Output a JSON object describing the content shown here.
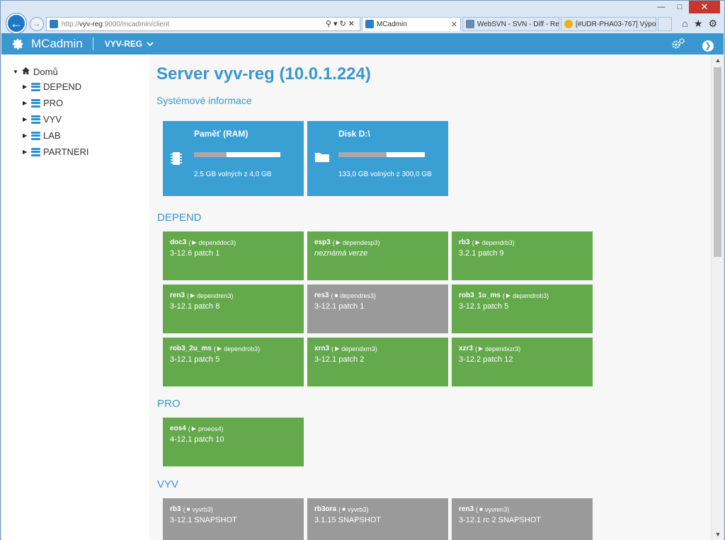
{
  "browser": {
    "url_prefix": "http://",
    "url_host": "vyv-reg",
    "url_rest": ":9000/mcadmin/client",
    "tabs": [
      {
        "label": "MCadmin",
        "active": true
      },
      {
        "label": "WebSVN - SVN - Diff - Re...",
        "active": false
      },
      {
        "label": "[#UDR-PHA03-767] Výpo...",
        "active": false
      }
    ]
  },
  "header": {
    "app_title": "MCadmin",
    "server_selector": "VYV-REG"
  },
  "sidebar": {
    "root": "Domů",
    "items": [
      {
        "label": "DEPEND"
      },
      {
        "label": "PRO"
      },
      {
        "label": "VYV"
      },
      {
        "label": "LAB"
      },
      {
        "label": "PARTNERI"
      }
    ]
  },
  "main": {
    "title": "Server vyv-reg (10.0.1.224)",
    "system_section": "Systémové informace",
    "ram": {
      "title": "Paměť (RAM)",
      "subtitle": "2,5 GB volných z 4,0 GB",
      "used_fraction": 0.375
    },
    "disk": {
      "title": "Disk D:\\",
      "subtitle": "133,0 GB volných z 300,0 GB",
      "used_fraction": 0.557
    },
    "groups": [
      {
        "name": "DEPEND",
        "servers": [
          {
            "name": "doc3",
            "instance": "dependdoc3",
            "version": "3-12.6 patch 1",
            "running": true,
            "unknown": false
          },
          {
            "name": "esp3",
            "instance": "dependesp3",
            "version": "neznámá verze",
            "running": true,
            "unknown": true
          },
          {
            "name": "rb3",
            "instance": "dependrb3",
            "version": "3.2.1 patch 9",
            "running": true,
            "unknown": false
          },
          {
            "name": "ren3",
            "instance": "dependren3",
            "version": "3-12.1 patch 8",
            "running": true,
            "unknown": false
          },
          {
            "name": "res3",
            "instance": "dependres3",
            "version": "3-12.1 patch 1",
            "running": false,
            "unknown": false
          },
          {
            "name": "rob3_1u_ms",
            "instance": "dependrob3",
            "version": "3-12.1 patch 5",
            "running": true,
            "unknown": false
          },
          {
            "name": "rob3_2u_ms",
            "instance": "dependrob3",
            "version": "3-12.1 patch 5",
            "running": true,
            "unknown": false
          },
          {
            "name": "xrn3",
            "instance": "dependxrn3",
            "version": "3-12.1 patch 2",
            "running": true,
            "unknown": false
          },
          {
            "name": "xzr3",
            "instance": "dependxzr3",
            "version": "3-12.2 patch 12",
            "running": true,
            "unknown": false
          }
        ]
      },
      {
        "name": "PRO",
        "servers": [
          {
            "name": "eos4",
            "instance": "proeos4",
            "version": "4-12.1 patch 10",
            "running": true,
            "unknown": false
          }
        ]
      },
      {
        "name": "VYV",
        "servers": [
          {
            "name": "rb3",
            "instance": "vyvrb3",
            "version": "3-12.1 SNAPSHOT",
            "running": false,
            "unknown": false
          },
          {
            "name": "rb3ora",
            "instance": "vyvrb3",
            "version": "3.1.15 SNAPSHOT",
            "running": false,
            "unknown": false
          },
          {
            "name": "ren3",
            "instance": "vyvren3",
            "version": "3-12.1 rc 2 SNAPSHOT",
            "running": false,
            "unknown": false
          }
        ]
      }
    ]
  },
  "colors": {
    "accent": "#3a97cf",
    "running": "#64a94c",
    "stopped": "#9a9a9a"
  }
}
